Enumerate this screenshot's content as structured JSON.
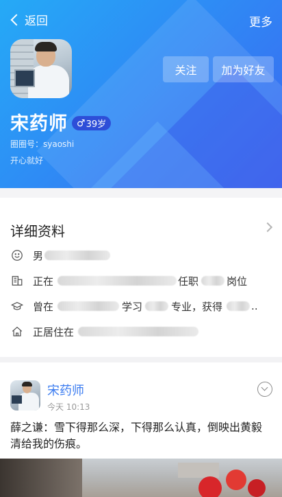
{
  "nav": {
    "back_label": "返回",
    "more_label": "更多"
  },
  "profile": {
    "name": "宋药师",
    "gender_symbol": "♂",
    "age": "39岁",
    "id_line": "圈圈号：syaoshi",
    "motto": "开心就好",
    "follow_label": "关注",
    "add_friend_label": "加为好友"
  },
  "details": {
    "title": "详细资料",
    "gender": "男",
    "work_prefix": "正在",
    "work_mid": "任职",
    "work_suffix": "岗位",
    "edu_prefix": "曾在",
    "edu_mid": "学习",
    "edu_major": "专业，获得",
    "edu_suffix": "..",
    "home_prefix": "正居住在"
  },
  "post": {
    "author": "宋药师",
    "time": "今天 10:13",
    "text": "薛之谦：雪下得那么深，下得那么认真，倒映出黄毅清给我的伤痕。"
  },
  "colors": {
    "header_start": "#25aaf6",
    "header_end": "#3b66f0",
    "link": "#3b7cf0",
    "badge": "#2d4ed8"
  }
}
